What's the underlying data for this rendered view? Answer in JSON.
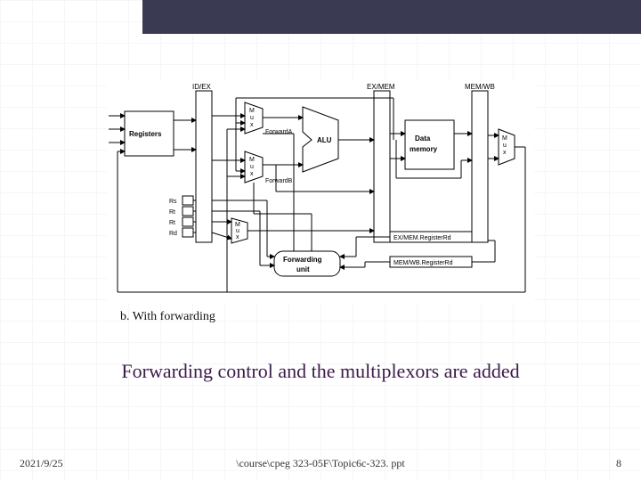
{
  "diagram": {
    "caption_b": "b. With forwarding",
    "main_caption": "Forwarding control and the multiplexors are added",
    "pipeline_registers": {
      "idex": "ID/EX",
      "exmem": "EX/MEM",
      "memwb": "MEM/WB"
    },
    "blocks": {
      "registers": "Registers",
      "mux1": "M\nu\nx",
      "mux2": "M\nu\nx",
      "mux3": "M\nu\nx",
      "mux4": "M\nu\nx",
      "alu": "ALU",
      "data_memory": "Data\nmemory",
      "forwarding_unit": "Forwarding\nunit"
    },
    "signals": {
      "forward_a": "ForwardA",
      "forward_b": "ForwardB",
      "rs": "Rs",
      "rt": "Rt",
      "rt2": "Rt",
      "rd": "Rd",
      "exmem_rd": "EX/MEM.RegisterRd",
      "memwb_rd": "MEM/WB.RegisterRd"
    }
  },
  "footer": {
    "date": "2021/9/25",
    "path": "\\course\\cpeg 323-05F\\Topic6c-323. ppt",
    "page": "8"
  }
}
